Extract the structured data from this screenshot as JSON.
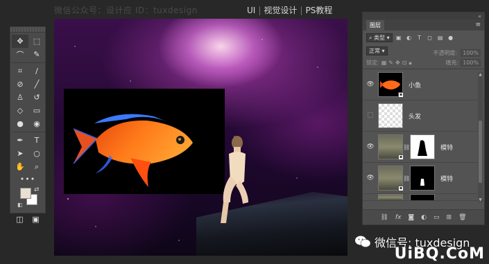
{
  "watermark": "微信公众号：设计应 ID：tuxdesign",
  "site_tags": [
    "UI",
    "视觉设计",
    "PS教程"
  ],
  "toolbar": {
    "tools": [
      "move-tool",
      "marquee-tool",
      "lasso-tool",
      "quick-select-tool",
      "crop-tool",
      "eyedropper-tool",
      "healing-brush-tool",
      "brush-tool",
      "clone-stamp-tool",
      "history-brush-tool",
      "eraser-tool",
      "gradient-tool",
      "blur-tool",
      "dodge-tool",
      "pen-tool",
      "type-tool",
      "path-select-tool",
      "ellipse-tool",
      "hand-tool",
      "zoom-tool"
    ],
    "more": "•••",
    "foreground_color": "#e8e0d0",
    "background_color": "#ffffff"
  },
  "layers_panel": {
    "title": "图层",
    "filter_label": "类型",
    "blend_mode": "正常",
    "opacity_label": "不透明度:",
    "opacity_value": "100%",
    "lock_label": "锁定:",
    "fill_label": "填充:",
    "fill_value": "100%",
    "layers": [
      {
        "name": "小鱼",
        "visible": true,
        "thumb": "fish",
        "mask": null
      },
      {
        "name": "头发",
        "visible": false,
        "thumb": "transparent",
        "mask": null
      },
      {
        "name": "模特",
        "visible": true,
        "thumb": "photo",
        "mask": "white-silhouette"
      },
      {
        "name": "模特",
        "visible": true,
        "thumb": "photo",
        "mask": "black-small"
      }
    ],
    "bottom_icons": [
      "link-icon",
      "fx-icon",
      "mask-icon",
      "adjustment-icon",
      "folder-icon",
      "new-layer-icon",
      "trash-icon"
    ]
  },
  "wechat_text": "微信号: tuxdesign",
  "corner_logo": "UiBQ.CoM"
}
